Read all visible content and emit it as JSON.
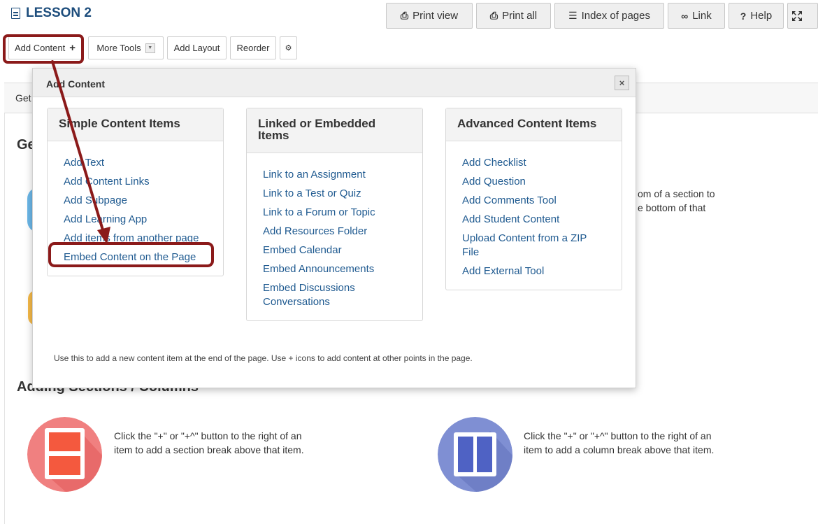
{
  "page": {
    "title": "LESSON 2"
  },
  "top_buttons": {
    "print_view": "Print view",
    "print_all": "Print all",
    "index": "Index of pages",
    "link": "Link",
    "help": "Help"
  },
  "toolbar": {
    "add_content": "Add Content",
    "more_tools": "More Tools",
    "add_layout": "Add Layout",
    "reorder": "Reorder"
  },
  "background": {
    "tab_label": "Get",
    "heading_1": "Ge",
    "right_text_1": "om of a section to",
    "right_text_2": "e bottom of that",
    "heading_2": "Adding Sections / Columns",
    "section_text_1": "Click the \"+\" or \"+^\" button to the right of an",
    "section_text_2": "item to add a section break above that item.",
    "column_text_1": "Click the \"+\" or \"+^\" button to the right of an",
    "column_text_2": "item to add a column break above that item."
  },
  "modal": {
    "title": "Add Content",
    "close": "×",
    "footer": "Use this to add a new content item at the end of the page. Use + icons to add content at other points in the page.",
    "simple": {
      "heading": "Simple Content Items",
      "items": [
        "Add Text",
        "Add Content Links",
        "Add Subpage",
        "Add Learning App",
        "Add items from another page",
        "Embed Content on the Page"
      ]
    },
    "linked": {
      "heading_1": "Linked or Embedded",
      "heading_2": "Items",
      "items": [
        "Link to an Assignment",
        "Link to a Test or Quiz",
        "Link to a Forum or Topic",
        "Add Resources Folder",
        "Embed Calendar",
        "Embed Announcements",
        "Embed Discussions Conversations"
      ]
    },
    "advanced": {
      "heading": "Advanced Content Items",
      "items": [
        "Add Checklist",
        "Add Question",
        "Add Comments Tool",
        "Add Student Content",
        "Upload Content from a ZIP File",
        "Add External Tool"
      ]
    }
  },
  "colors": {
    "title_blue": "#1d4d7c",
    "link_blue": "#1f5a90",
    "highlight_red": "#8b1a1a",
    "section_icon_red": "#f08080",
    "column_icon_blue": "#7f8fd3"
  }
}
